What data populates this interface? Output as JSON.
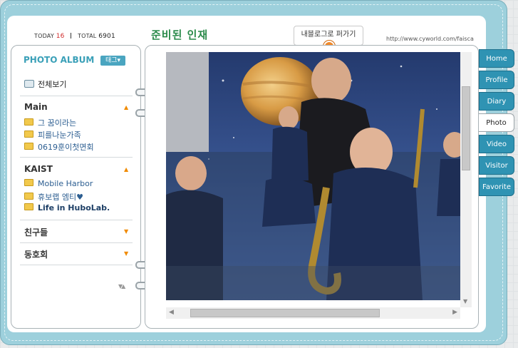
{
  "header": {
    "today_label": "TODAY",
    "today_count": "16",
    "total_label": "TOTAL",
    "total_count": "6901",
    "site_title": "준비된 인재",
    "blog_tag": "내블로그로 퍼가기",
    "url": "http://www.cyworld.com/faisca"
  },
  "sidebar": {
    "album_title": "PHOTO ALBUM",
    "tag_button": "태그▾",
    "all_view": "전체보기",
    "groups": [
      {
        "name": "Main",
        "items": [
          "그 꿈이라는",
          "피를나눈가족",
          "0619훈이첫면회"
        ]
      },
      {
        "name": "KAIST",
        "items": [
          "Mobile Harbor",
          "휴보랩 엠티♥",
          "Life in HuboLab."
        ]
      },
      {
        "name": "친구들",
        "items": []
      },
      {
        "name": "동호회",
        "items": []
      }
    ]
  },
  "tabs": [
    "Home",
    "Profile",
    "Diary",
    "Photo",
    "Video",
    "Visitor",
    "Favorite"
  ],
  "active_tab": "Photo",
  "colors": {
    "frame": "#9dd0dc",
    "tab": "#2f93b3",
    "title_green": "#2a8a4a",
    "album_blue": "#3aa0b8"
  }
}
